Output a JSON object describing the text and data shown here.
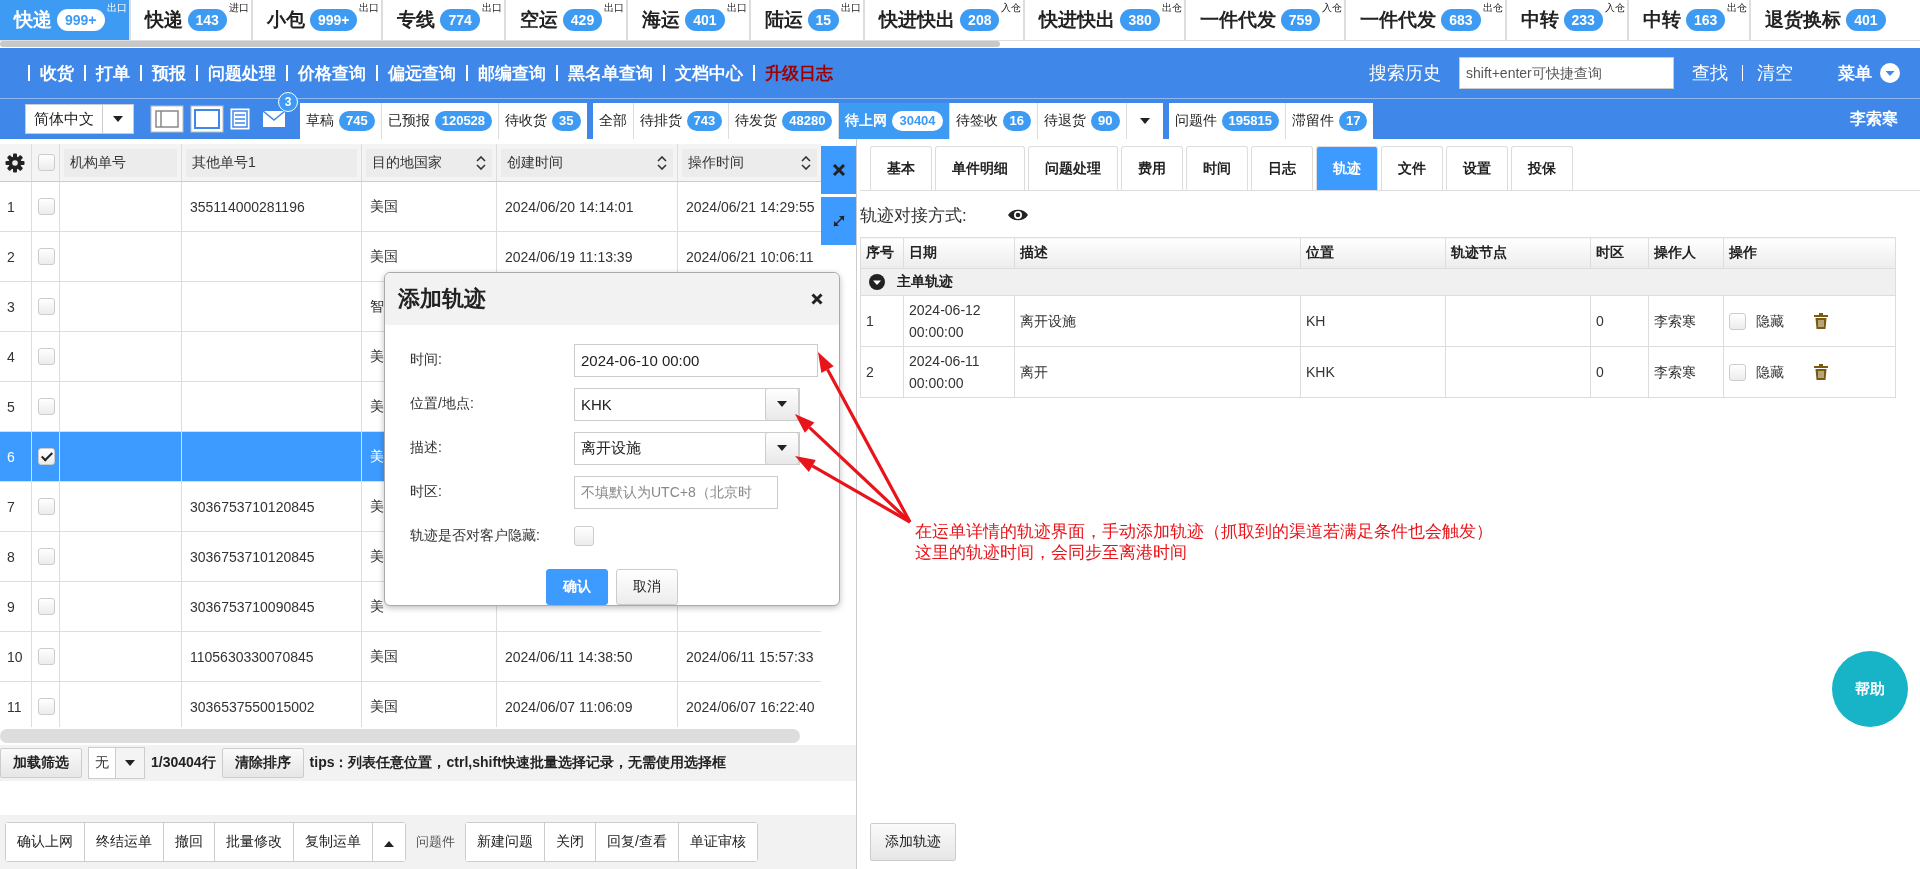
{
  "top_tabs": [
    {
      "label": "快递",
      "count": "999+",
      "tag": "出口",
      "selected": true
    },
    {
      "label": "快递",
      "count": "143",
      "tag": "进口",
      "selected": false
    },
    {
      "label": "小包",
      "count": "999+",
      "tag": "出口",
      "selected": false
    },
    {
      "label": "专线",
      "count": "774",
      "tag": "出口",
      "selected": false
    },
    {
      "label": "空运",
      "count": "429",
      "tag": "出口",
      "selected": false
    },
    {
      "label": "海运",
      "count": "401",
      "tag": "出口",
      "selected": false
    },
    {
      "label": "陆运",
      "count": "15",
      "tag": "出口",
      "selected": false
    },
    {
      "label": "快进快出",
      "count": "208",
      "tag": "入仓",
      "selected": false
    },
    {
      "label": "快进快出",
      "count": "380",
      "tag": "出仓",
      "selected": false
    },
    {
      "label": "一件代发",
      "count": "759",
      "tag": "入仓",
      "selected": false
    },
    {
      "label": "一件代发",
      "count": "683",
      "tag": "出仓",
      "selected": false
    },
    {
      "label": "中转",
      "count": "233",
      "tag": "入仓",
      "selected": false
    },
    {
      "label": "中转",
      "count": "163",
      "tag": "出仓",
      "selected": false
    },
    {
      "label": "退货换标",
      "count": "401",
      "selected": false
    }
  ],
  "nav_menu": [
    {
      "label": "收货",
      "highlighted": false
    },
    {
      "label": "打单",
      "highlighted": false
    },
    {
      "label": "预报",
      "highlighted": false
    },
    {
      "label": "问题处理",
      "highlighted": false
    },
    {
      "label": "价格查询",
      "highlighted": false
    },
    {
      "label": "偏远查询",
      "highlighted": false
    },
    {
      "label": "邮编查询",
      "highlighted": false
    },
    {
      "label": "黑名单查询",
      "highlighted": false
    },
    {
      "label": "文档中心",
      "highlighted": false
    },
    {
      "label": "升级日志",
      "highlighted": true
    }
  ],
  "search": {
    "history_label": "搜索历史",
    "placeholder": "shift+enter可快捷查询",
    "find_button": "查找",
    "clear_button": "清空",
    "menu_label": "菜单"
  },
  "toolbar": {
    "language": "简体中文",
    "mail_count": "3",
    "user": "李索寒",
    "status_groups": [
      {
        "dropdown": false,
        "items": [
          {
            "label": "草稿",
            "count": "745",
            "selected": false
          },
          {
            "label": "已预报",
            "count": "120528",
            "selected": false
          },
          {
            "label": "待收货",
            "count": "35",
            "selected": false
          }
        ]
      },
      {
        "dropdown": true,
        "items": [
          {
            "label": "全部",
            "selected": false
          },
          {
            "label": "待排货",
            "count": "743",
            "selected": false
          },
          {
            "label": "待发货",
            "count": "48280",
            "selected": false
          },
          {
            "label": "待上网",
            "count": "30404",
            "selected": true
          },
          {
            "label": "待签收",
            "count": "16",
            "selected": false
          },
          {
            "label": "待退货",
            "count": "90",
            "selected": false
          }
        ]
      },
      {
        "dropdown": false,
        "items": [
          {
            "label": "问题件",
            "count": "195815",
            "selected": false
          },
          {
            "label": "滞留件",
            "count": "17",
            "selected": false
          }
        ]
      }
    ]
  },
  "order_table": {
    "all_checked": false,
    "columns": [
      {
        "label": "机构单号",
        "sortable": false
      },
      {
        "label": "其他单号1",
        "sortable": false
      },
      {
        "label": "目的地国家",
        "sortable": true
      },
      {
        "label": "创建时间",
        "sortable": true
      },
      {
        "label": "操作时间",
        "sortable": true
      }
    ],
    "rows": [
      {
        "number": "1",
        "checked": false,
        "selected": false,
        "other_no": "355114000281196",
        "country": "美国",
        "created_at": "2024/06/20 14:14:01",
        "operated_at": "2024/06/21 14:29:55"
      },
      {
        "number": "2",
        "checked": false,
        "selected": false,
        "country": "美国",
        "created_at": "2024/06/19 11:13:39",
        "operated_at": "2024/06/21 10:06:11"
      },
      {
        "number": "3",
        "checked": false,
        "selected": false,
        "country": "智"
      },
      {
        "number": "4",
        "checked": false,
        "selected": false,
        "country": "美"
      },
      {
        "number": "5",
        "checked": false,
        "selected": false,
        "country": "美"
      },
      {
        "number": "6",
        "checked": true,
        "selected": true,
        "country": "美"
      },
      {
        "number": "7",
        "checked": false,
        "selected": false,
        "other_no": "3036753710120845",
        "country": "美"
      },
      {
        "number": "8",
        "checked": false,
        "selected": false,
        "other_no": "3036753710120845",
        "country": "美"
      },
      {
        "number": "9",
        "checked": false,
        "selected": false,
        "other_no": "3036753710090845",
        "country": "美"
      },
      {
        "number": "10",
        "checked": false,
        "selected": false,
        "other_no": "1105630330070845",
        "country": "美国",
        "created_at": "2024/06/11 14:38:50",
        "operated_at": "2024/06/11 15:57:33"
      },
      {
        "number": "11",
        "checked": false,
        "selected": false,
        "other_no": "3036537550015002",
        "country": "美国",
        "created_at": "2024/06/07 11:06:09",
        "operated_at": "2024/06/07 16:22:40"
      }
    ]
  },
  "list_footer": {
    "filter_button": "加载筛选",
    "filter_value": "无",
    "page_info": "1/30404行",
    "clear_sort_button": "清除排序",
    "tips": "tips：列表任意位置，ctrl,shift快速批量选择记录，无需使用选择框"
  },
  "bottom_actions": {
    "buttons": [
      "确认上网",
      "终结运单",
      "撤回",
      "批量修改",
      "复制运单"
    ],
    "issue_label": "问题件",
    "issue_buttons": [
      "新建问题",
      "关闭",
      "回复/查看",
      "单证审核"
    ]
  },
  "detail": {
    "tabs": [
      {
        "label": "基本",
        "selected": false
      },
      {
        "label": "单件明细",
        "selected": false
      },
      {
        "label": "问题处理",
        "selected": false
      },
      {
        "label": "费用",
        "selected": false
      },
      {
        "label": "时间",
        "selected": false
      },
      {
        "label": "日志",
        "selected": false
      },
      {
        "label": "轨迹",
        "selected": true
      },
      {
        "label": "文件",
        "selected": false
      },
      {
        "label": "设置",
        "selected": false
      },
      {
        "label": "投保",
        "selected": false
      }
    ],
    "link_method_label": "轨迹对接方式:",
    "track_table": {
      "columns": [
        "序号",
        "日期",
        "描述",
        "位置",
        "轨迹节点",
        "时区",
        "操作人",
        "操作"
      ],
      "group": {
        "label": "主单轨迹",
        "expanded": true
      },
      "rows": [
        {
          "number": "1",
          "date": "2024-06-12 00:00:00",
          "description": "离开设施",
          "location": "KH",
          "timezone": "0",
          "operator": "李索寒",
          "hidden": false,
          "hide_label": "隐藏"
        },
        {
          "number": "2",
          "date": "2024-06-11 00:00:00",
          "description": "离开",
          "location": "KHK",
          "timezone": "0",
          "operator": "李索寒",
          "hidden": false,
          "hide_label": "隐藏"
        }
      ]
    },
    "add_button": "添加轨迹",
    "help_button": "帮助"
  },
  "dialog": {
    "title": "添加轨迹",
    "fields": [
      {
        "kind": "text",
        "label": "时间:",
        "value": "2024-06-10 00:00"
      },
      {
        "kind": "select",
        "label": "位置/地点:",
        "value": "KHK"
      },
      {
        "kind": "select",
        "label": "描述:",
        "value": "离开设施"
      },
      {
        "kind": "text",
        "label": "时区:",
        "placeholder": "不填默认为UTC+8（北京时"
      },
      {
        "kind": "checkbox",
        "label": "轨迹是否对客户隐藏:",
        "checked": false
      }
    ],
    "buttons": [
      {
        "label": "确认",
        "primary": true
      },
      {
        "label": "取消",
        "primary": false
      }
    ]
  },
  "annotation": {
    "lines": [
      "在运单详情的轨迹界面，手动添加轨迹（抓取到的渠道若满足条件也会触发）",
      "这里的轨迹时间，会同步至离港时间"
    ]
  }
}
